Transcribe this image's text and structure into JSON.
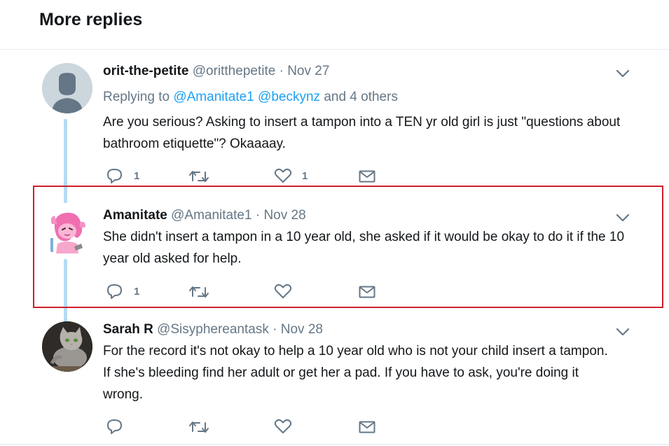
{
  "section": {
    "title": "More replies"
  },
  "tweets": [
    {
      "name": "orit-the-petite",
      "handle": "@oritthepetite",
      "separator": "·",
      "date": "Nov 27",
      "replying_prefix": "Replying to",
      "replying_users": [
        "@Amanitate1",
        "@beckynz"
      ],
      "replying_suffix": "and 4 others",
      "text": "Are you serious? Asking to insert a tampon into a TEN yr old girl is just \"questions about bathroom etiquette\"? Okaaaay.",
      "reply_count": "1",
      "retweet_count": "",
      "like_count": "1",
      "avatar": "default-user-icon"
    },
    {
      "name": "Amanitate",
      "handle": "@Amanitate1",
      "separator": "·",
      "date": "Nov 28",
      "text": "She didn't insert a tampon in a 10 year old, she asked if it would be okay to do it if the 10 year old asked for help.",
      "reply_count": "1",
      "retweet_count": "",
      "like_count": "",
      "avatar": "pink-pony-avatar"
    },
    {
      "name": "Sarah R",
      "handle": "@Sisyphereantask",
      "separator": "·",
      "date": "Nov 28",
      "text": "For the record it's not okay to help a 10 year old who is not your child insert a tampon.  If she's bleeding find her adult or get her a pad.  If you have to ask, you're doing it wrong.",
      "reply_count": "",
      "retweet_count": "",
      "like_count": "",
      "avatar": "gray-cat-photo"
    }
  ],
  "colors": {
    "accent": "#1da1f2",
    "muted": "#657786",
    "thread_line": "#b3dcf5",
    "highlight_box": "#d0202c"
  }
}
